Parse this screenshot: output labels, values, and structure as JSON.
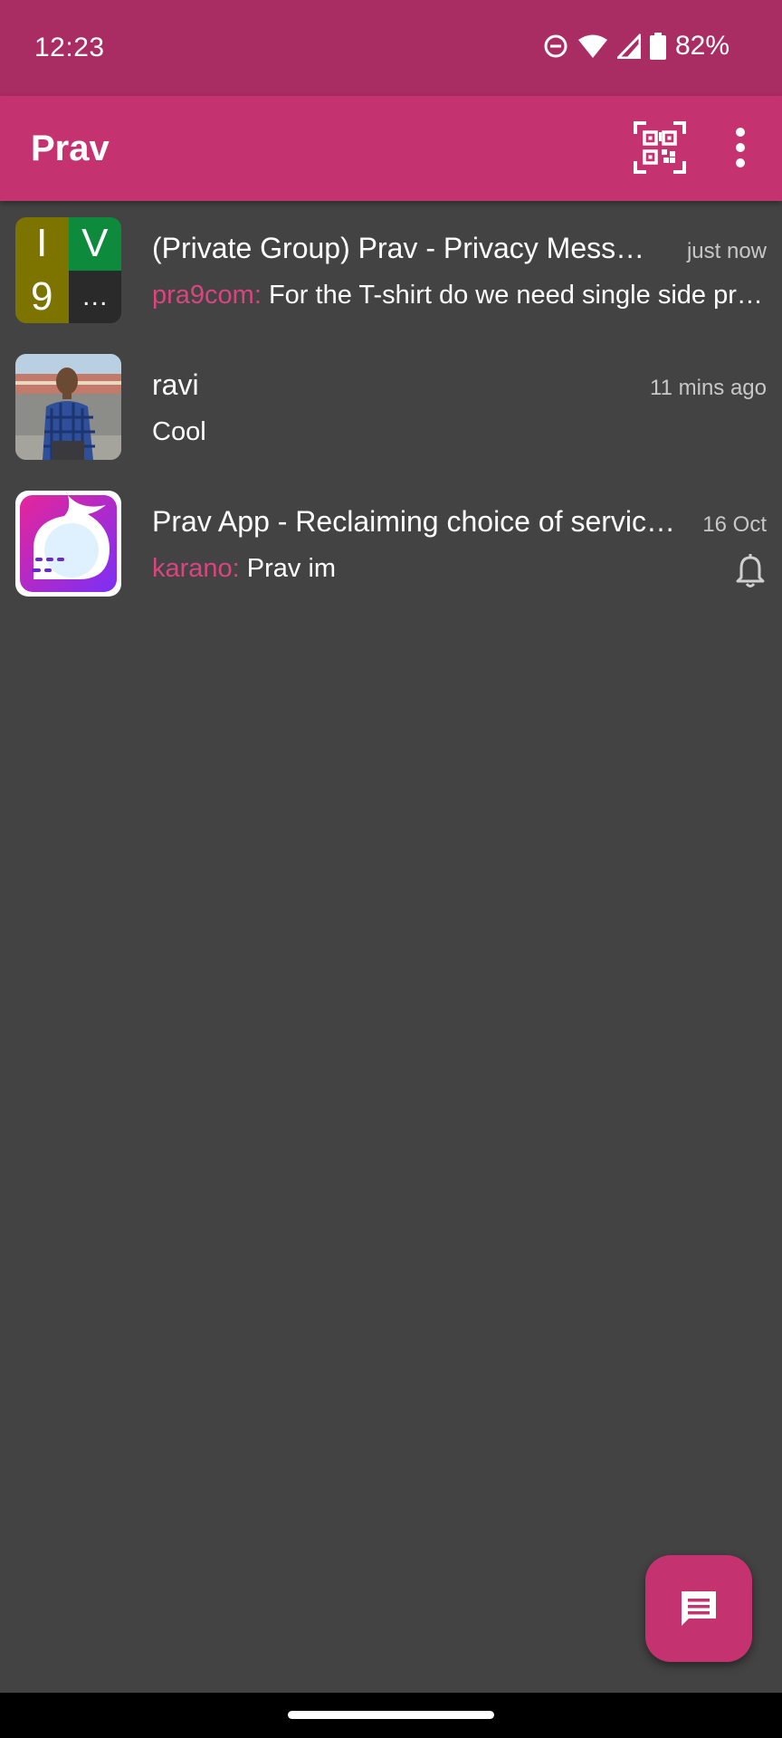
{
  "status_bar": {
    "time": "12:23",
    "battery": "82%",
    "icons": [
      "do-not-disturb-icon",
      "wifi-icon",
      "cell-signal-icon",
      "battery-icon"
    ]
  },
  "app_bar": {
    "title": "Prav",
    "actions": [
      "qr-code-icon",
      "more-vert-icon"
    ]
  },
  "chats": [
    {
      "title": "(Private Group) Prav - Privacy Messe…",
      "time": "just now",
      "sender": "pra9com:",
      "preview": "For the T-shirt do we need single side pr…",
      "avatar": {
        "letters": [
          "I",
          "V",
          "9",
          "…"
        ],
        "colors": [
          "#7d7400",
          "#0d8a3c",
          "#7d7400",
          "#2a2a2a"
        ]
      }
    },
    {
      "title": "ravi",
      "time": "11 mins ago",
      "sender": "",
      "preview": "Cool"
    },
    {
      "title": "Prav App - Reclaiming choice of servic…",
      "time": "16 Oct",
      "sender": "karano:",
      "preview": "Prav im",
      "muted_icon": "bell-icon"
    }
  ],
  "fab": {
    "icon": "new-message-icon"
  },
  "colors": {
    "status_bar": "#a92c62",
    "app_bar": "#c4336f",
    "background": "#434343",
    "accent_sender": "#d8457f"
  }
}
